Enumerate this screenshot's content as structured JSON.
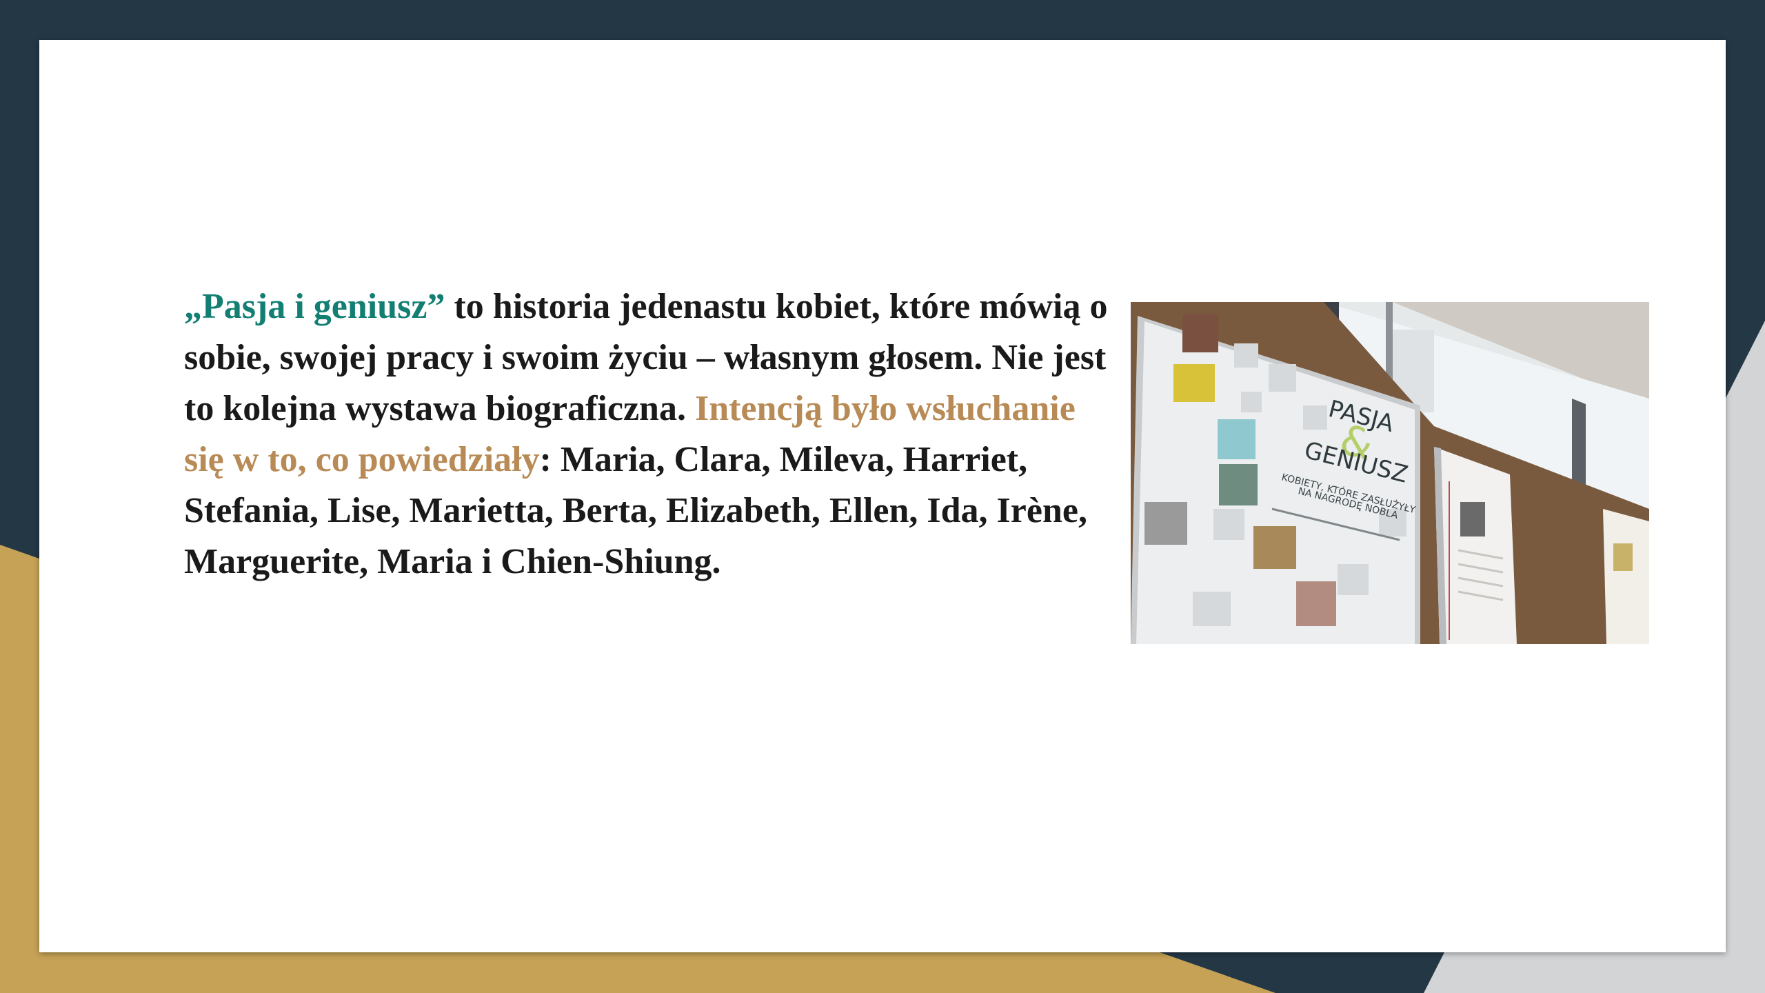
{
  "slide": {
    "paragraph": {
      "part1_highlight": "„Pasja i geniusz”",
      "part2": " to historia jedenastu kobiet, które mówią o sobie, swojej pracy i swoim życiu – własnym głosem. Nie jest to kolejna wystawa biograficzna. ",
      "part3_highlight": "Intencją było wsłuchanie się w to, co powiedziały",
      "part4": ": Maria, Clara, Mileva, Harriet, Stefania, Lise, Marietta, Berta, Elizabeth, Ellen, Ida, Irène, Marguerite, Maria i Chien-Shiung."
    },
    "photo": {
      "poster_title_1": "PASJA",
      "poster_amp": "&",
      "poster_title_2": "GENIUSZ",
      "poster_sub_1": "KOBIETY, KTÓRE ZASŁUŻYŁY",
      "poster_sub_2": "NA NAGRODĘ NOBLA"
    }
  },
  "colors": {
    "background": "#233745",
    "gold": "#c6a257",
    "teal_highlight": "#137f73",
    "tan_highlight": "#b88a55"
  }
}
